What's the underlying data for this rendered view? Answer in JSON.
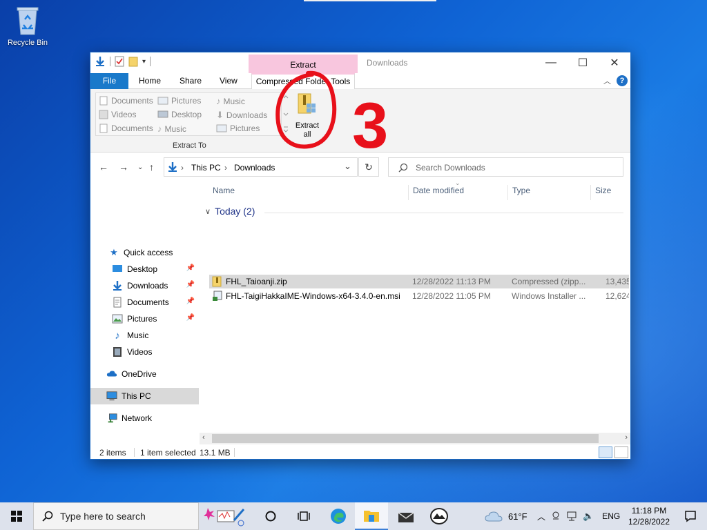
{
  "desktop": {
    "recycle_bin_label": "Recycle Bin"
  },
  "window": {
    "title": "Downloads",
    "contextual_tab_header": "Extract",
    "tabs": {
      "file": "File",
      "home": "Home",
      "share": "Share",
      "view": "View",
      "compressed_folder_tools": "Compressed Folder Tools"
    },
    "ribbon": {
      "gallery_items": [
        {
          "label": "Documents",
          "icon": "document-icon"
        },
        {
          "label": "Pictures",
          "icon": "pictures-icon"
        },
        {
          "label": "Music",
          "icon": "music-icon"
        },
        {
          "label": "Videos",
          "icon": "videos-icon"
        },
        {
          "label": "Desktop",
          "icon": "desktop-icon"
        },
        {
          "label": "Downloads",
          "icon": "downloads-icon"
        },
        {
          "label": "Documents",
          "icon": "document-icon"
        },
        {
          "label": "Music",
          "icon": "music-icon"
        },
        {
          "label": "Pictures",
          "icon": "pictures-icon"
        }
      ],
      "extract_all_line1": "Extract",
      "extract_all_line2": "all",
      "group_label": "Extract To"
    },
    "address": {
      "segments": [
        "This PC",
        "Downloads"
      ]
    },
    "search": {
      "placeholder": "Search Downloads"
    },
    "nav_pane": {
      "quick_access": "Quick access",
      "items": [
        {
          "label": "Desktop",
          "pinned": true
        },
        {
          "label": "Downloads",
          "pinned": true
        },
        {
          "label": "Documents",
          "pinned": true
        },
        {
          "label": "Pictures",
          "pinned": true
        },
        {
          "label": "Music",
          "pinned": false
        },
        {
          "label": "Videos",
          "pinned": false
        }
      ],
      "onedrive": "OneDrive",
      "this_pc": "This PC",
      "network": "Network"
    },
    "columns": {
      "name": "Name",
      "date_modified": "Date modified",
      "type": "Type",
      "size": "Size"
    },
    "group_header": "Today (2)",
    "files": [
      {
        "name": "FHL_Taioanji.zip",
        "date": "12/28/2022 11:13 PM",
        "type": "Compressed (zipp...",
        "size": "13,435",
        "selected": true
      },
      {
        "name": "FHL-TaigiHakkaIME-Windows-x64-3.4.0-en.msi",
        "date": "12/28/2022 11:05 PM",
        "type": "Windows Installer ...",
        "size": "12,624",
        "selected": false
      }
    ],
    "status": {
      "items": "2 items",
      "selected": "1 item selected",
      "size": "13.1 MB"
    }
  },
  "annotation": {
    "step_number": "3",
    "color": "#e8101a"
  },
  "taskbar": {
    "search_placeholder": "Type here to search",
    "weather": "61°F",
    "language": "ENG",
    "time": "11:18 PM",
    "date": "12/28/2022"
  }
}
